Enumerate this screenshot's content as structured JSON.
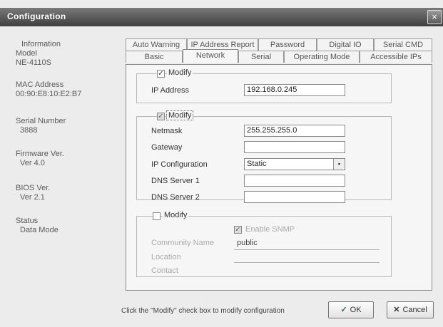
{
  "window": {
    "title": "Configuration",
    "close_symbol": "×"
  },
  "info": [
    {
      "label": "Information",
      "value": "Model",
      "value2": "NE-4110S"
    },
    {
      "label": "MAC Address",
      "value": "00:90:E8:10:E2:B7"
    },
    {
      "label": "Serial Number",
      "value": "3888"
    },
    {
      "label": "Firmware Ver.",
      "value": "Ver 4.0"
    },
    {
      "label": "BIOS Ver.",
      "value": "Ver 2.1"
    },
    {
      "label": "Status",
      "value": "Data Mode"
    }
  ],
  "tabs_back": [
    "Auto Warning",
    "IP Address Report",
    "Password",
    "Digital IO",
    "Serial CMD"
  ],
  "tabs_front": [
    "Basic",
    "Network",
    "Serial",
    "Operating Mode",
    "Accessible IPs"
  ],
  "active_tab": "Network",
  "ip_group": {
    "modify_label": "Modify",
    "ip_label": "IP Address",
    "ip_value": "192.168.0.245"
  },
  "net_group": {
    "modify_label": "Modify",
    "netmask_label": "Netmask",
    "netmask_value": "255.255.255.0",
    "gateway_label": "Gateway",
    "gateway_value": "",
    "ipconfig_label": "IP Configuration",
    "ipconfig_value": "Static",
    "dns1_label": "DNS Server 1",
    "dns1_value": "",
    "dns2_label": "DNS Server 2",
    "dns2_value": ""
  },
  "snmp_group": {
    "modify_label": "Modify",
    "enable_label": "Enable SNMP",
    "community_label": "Community Name",
    "community_value": "public",
    "location_label": "Location",
    "contact_label": "Contact"
  },
  "footer": {
    "hint": "Click the \"Modify\" check box to modify configuration",
    "ok_label": "OK",
    "cancel_label": "Cancel"
  }
}
